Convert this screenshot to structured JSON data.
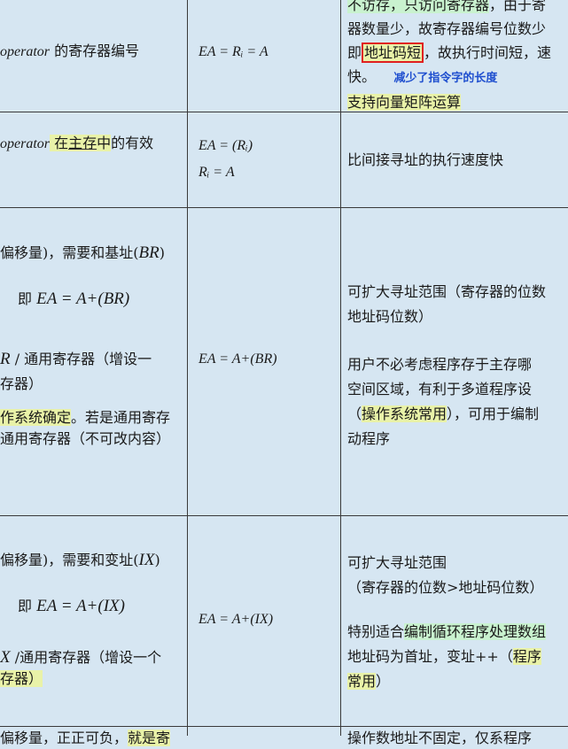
{
  "row1": {
    "desc_italic": "operator",
    "desc_rest": " 的寄存器编号",
    "formula": "EA = Rᵢ = A",
    "note": {
      "line1_hl": "不访存，只访问寄存器",
      "line1_rest": "，由于寄",
      "line2": "器数量少，故寄存器编号位数少",
      "line3_pre": "即",
      "line3_boxed": "地址码短",
      "line3_rest": "，故执行时间短，速",
      "line4_pre": "快。",
      "line4_blue": "减少了指令字的长度",
      "line5_hl": "支持向量矩阵运算"
    }
  },
  "row2": {
    "desc_italic": "operator",
    "desc_hl_pre": " 在",
    "desc_hl_ul": "主存",
    "desc_hl_post": "中",
    "desc_rest": "的有效",
    "formula_line1": "EA = (Rᵢ)",
    "formula_line2": "Rᵢ = A",
    "note": "比间接寻址的执行速度快"
  },
  "row3": {
    "desc": {
      "line1_pre": "偏移量)，需要和基址(",
      "line1_it": "BR",
      "line1_post": ")",
      "line2_pre": "即 ",
      "line2_formula": "EA = A+(BR)",
      "line3_it": "R",
      "line3_rest": " / 通用寄存器（增设一",
      "line4": "存器）",
      "line5_hl": "作系统确定",
      "line5_rest": "。若是通用寄存",
      "line6": "通用寄存器（不可改内容）"
    },
    "formula": "EA = A+(BR)",
    "note": {
      "line1": "可扩大寻址范围（寄存器的位数",
      "line2": "地址码位数）",
      "line3": "用户不必考虑程序存于主存哪",
      "line4": "空间区域，有利于多道程序设",
      "line5_pre": "（",
      "line5_hl": "操作系统常用",
      "line5_rest": "），可用于编制",
      "line6": "动程序"
    }
  },
  "row4": {
    "desc": {
      "line1_pre": "偏移量)，需要和变址(",
      "line1_it": "IX",
      "line1_post": ")",
      "line2_pre": "即 ",
      "line2_formula": "EA = A+(IX)",
      "line3_it": "X",
      "line3_rest": " /通用寄存器（增设一个",
      "line4_hl": "存器）"
    },
    "formula": "EA = A+(IX)",
    "note": {
      "line1": "可扩大寻址范围",
      "line2": "（寄存器的位数>地址码位数）",
      "line3_pre": "特别适合",
      "line3_hl": "编制循环程序处理数组",
      "line4_pre": "地址码为首址，变址++（",
      "line4_hl": "程序",
      "line5_hl": "常用",
      "line5_rest": "）"
    }
  },
  "row5": {
    "desc_partial": "偏移量，正正可负，",
    "desc_partial_hl": "就是寄",
    "note_partial": "操作数地址不固定，仅系程序"
  }
}
